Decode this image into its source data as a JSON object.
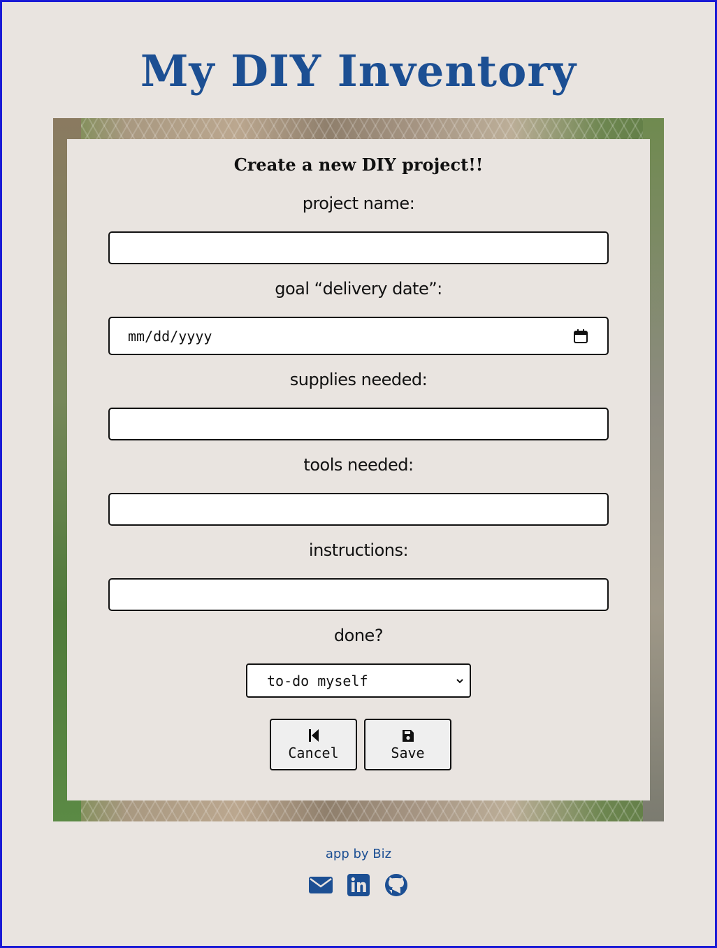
{
  "header": {
    "title": "My DIY Inventory"
  },
  "form": {
    "heading": "Create a new DIY project!!",
    "project_name_label": "project name:",
    "delivery_date_label": "goal “delivery date”:",
    "delivery_date_placeholder": "mm/dd/yyyy",
    "supplies_label": "supplies needed:",
    "tools_label": "tools needed:",
    "instructions_label": "instructions:",
    "done_label": "done?",
    "done_selected": "to-do myself",
    "cancel_label": "Cancel",
    "save_label": "Save"
  },
  "footer": {
    "credit": "app by Biz",
    "icons": [
      "envelope-icon",
      "linkedin-icon",
      "github-icon"
    ]
  },
  "colors": {
    "brand": "#1c4f93",
    "background": "#e9e4e0",
    "page_border": "#1a1ad6"
  }
}
